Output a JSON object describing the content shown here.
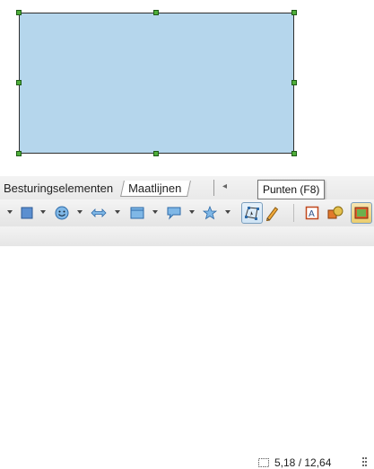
{
  "tabs": {
    "controls": "Besturingselementen",
    "dimensions": "Maatlijnen"
  },
  "tooltip": {
    "text": "Punten (F8)"
  },
  "status": {
    "position": "5,18 / 12,64"
  },
  "shape": {
    "fill": "#b5d6ec",
    "border": "#2f2f2f",
    "handle_color": "#4fae3a"
  },
  "toolbar": {
    "icons": [
      "square-icon",
      "smiley-icon",
      "double-arrow-icon",
      "flowchart-icon",
      "callout-icon",
      "star-icon",
      "points-icon",
      "pencil-icon",
      "text-frame-icon",
      "fontwork-icon",
      "extrusion-icon"
    ]
  }
}
